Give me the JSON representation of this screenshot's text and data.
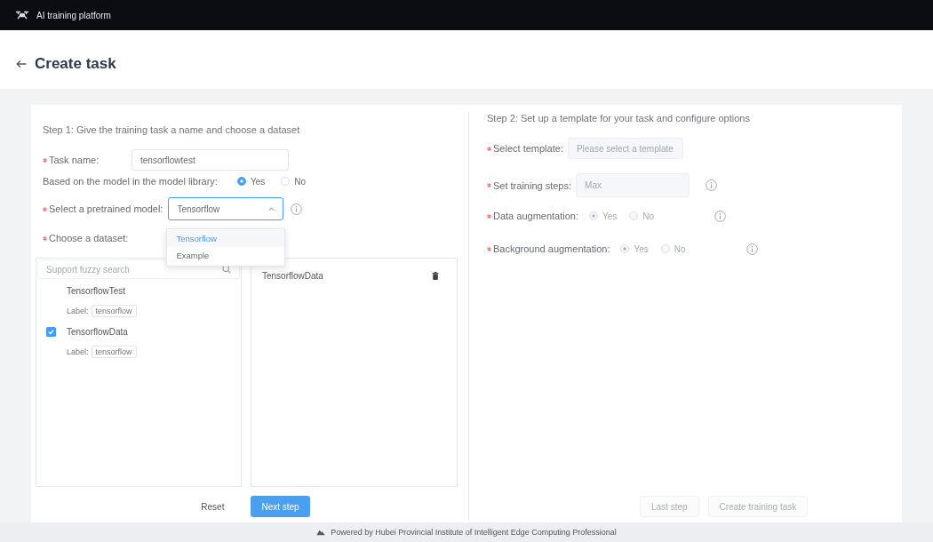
{
  "header": {
    "title": "AI training platform"
  },
  "page": {
    "title": "Create task"
  },
  "step1": {
    "heading": "Step 1: Give the training task a name and choose a dataset",
    "task_name": {
      "label": "Task name:",
      "required": true,
      "value": "tensorflowtest"
    },
    "model_library": {
      "label": "Based on the model in the model library:",
      "options": [
        {
          "label": "Yes",
          "selected": true
        },
        {
          "label": "No",
          "selected": false
        }
      ]
    },
    "pretrained_model": {
      "label": "Select a pretrained model:",
      "required": true,
      "value": "Tensorflow",
      "focused": true,
      "expanded": true,
      "options": [
        {
          "label": "Tensorflow",
          "selected": true
        },
        {
          "label": "Example",
          "selected": false
        }
      ]
    },
    "dataset": {
      "label": "Choose a dataset:",
      "required": true,
      "search": {
        "placeholder": "Support fuzzy search"
      },
      "items": [
        {
          "name": "TensorflowTest",
          "checked": false,
          "tag_caption": "Label:",
          "tag": "tensorflow"
        },
        {
          "name": "TensorflowData",
          "checked": true,
          "tag_caption": "Label:",
          "tag": "tensorflow"
        }
      ],
      "chosen": [
        {
          "name": "TensorflowData"
        }
      ]
    },
    "buttons": [
      {
        "label": "Reset",
        "kind": "plain",
        "disabled": false
      },
      {
        "label": "Next step",
        "kind": "primary",
        "disabled": false
      }
    ]
  },
  "step2": {
    "heading": "Step 2: Set up a template for your task and configure options",
    "template": {
      "label": "Select template:",
      "required": true,
      "placeholder": "Please select a template",
      "disabled": true
    },
    "training_steps": {
      "label": "Set training steps:",
      "required": true,
      "placeholder": "Max",
      "disabled": true
    },
    "data_augmentation": {
      "label": "Data augmentation:",
      "required": true,
      "disabled": true,
      "options": [
        {
          "label": "Yes",
          "selected": true
        },
        {
          "label": "No",
          "selected": false
        }
      ]
    },
    "background_augmentation": {
      "label": "Background augmentation:",
      "required": true,
      "disabled": true,
      "options": [
        {
          "label": "Yes",
          "selected": true
        },
        {
          "label": "No",
          "selected": false
        }
      ]
    },
    "buttons": [
      {
        "label": "Last step",
        "kind": "plain",
        "disabled": true
      },
      {
        "label": "Create training task",
        "kind": "plain",
        "disabled": true
      }
    ]
  },
  "footer": {
    "text": "Powered by Hubei Provincial Institute of Intelligent Edge Computing Professional"
  }
}
